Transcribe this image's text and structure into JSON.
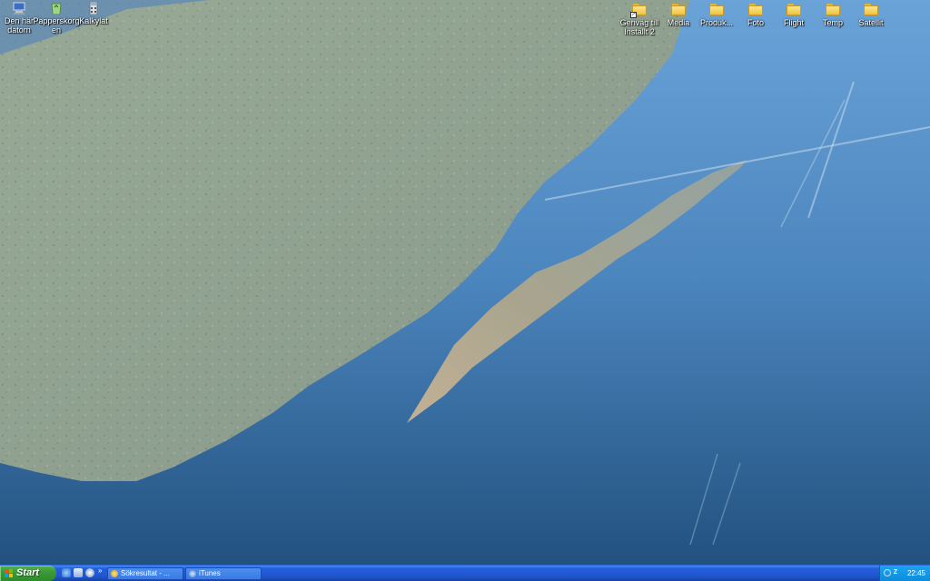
{
  "desktop": {
    "left_icons": [
      {
        "name": "my-computer",
        "label": "Den här datorn",
        "icon": "computer-icon"
      },
      {
        "name": "recycle-bin",
        "label": "Papperskorgen",
        "icon": "recycle-bin-icon"
      },
      {
        "name": "calculator",
        "label": "Kalkylat",
        "icon": "calculator-icon"
      }
    ],
    "right_icons": [
      {
        "name": "shortcut-1",
        "label": "Genväg till Inställt 2",
        "icon": "folder-shortcut-icon"
      },
      {
        "name": "media",
        "label": "Media",
        "icon": "folder-icon"
      },
      {
        "name": "produkt",
        "label": "Produk...",
        "icon": "folder-icon"
      },
      {
        "name": "foto",
        "label": "Foto",
        "icon": "folder-icon"
      },
      {
        "name": "flight",
        "label": "Flight",
        "icon": "folder-icon"
      },
      {
        "name": "temp",
        "label": "Temp",
        "icon": "folder-icon"
      },
      {
        "name": "satellit",
        "label": "Satellit",
        "icon": "folder-icon"
      }
    ]
  },
  "taskbar": {
    "start_label": "Start",
    "quick_launch_more": "»",
    "tasks": [
      {
        "label": "Sökresultat - ...",
        "icon": "search-results-icon"
      },
      {
        "label": "iTunes",
        "icon": "itunes-icon"
      }
    ],
    "tray": {
      "clock": "22:45",
      "icons": [
        "network-icon",
        "z-app-icon"
      ]
    }
  },
  "colors": {
    "taskbar_blue": "#245edb",
    "start_green": "#3c9a38",
    "tray_blue": "#0d8ddc"
  }
}
